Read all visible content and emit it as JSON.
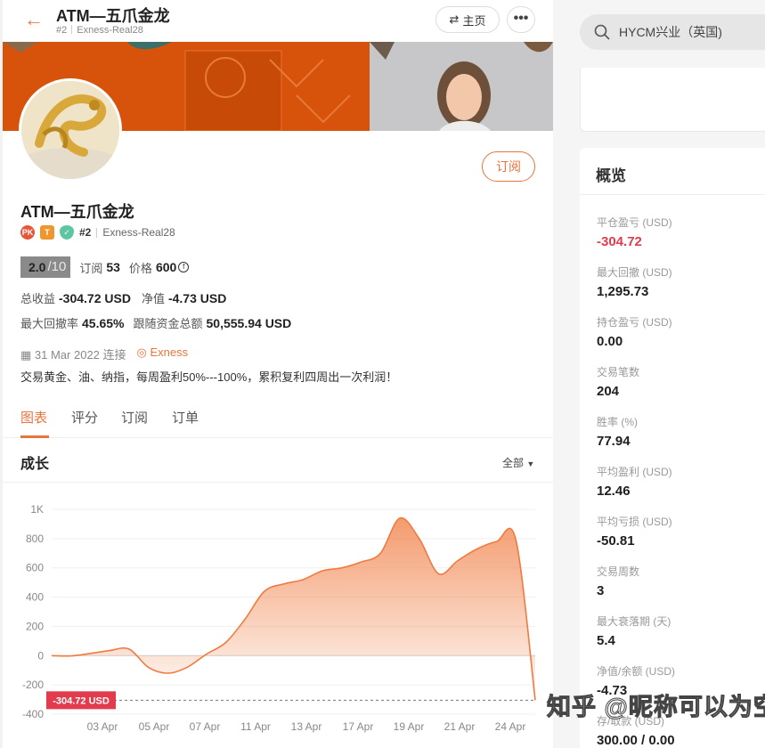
{
  "header": {
    "title": "ATM—五爪金龙",
    "rank": "#2",
    "server": "Exness-Real28",
    "home_label": "主页",
    "more_label": "•••",
    "back_label": "←"
  },
  "profile": {
    "name": "ATM—五爪金龙",
    "rank": "#2",
    "server": "Exness-Real28",
    "badges": [
      "PK",
      "T",
      "✓"
    ],
    "subscribe_label": "订阅",
    "score": "2.0",
    "score_max": "/10",
    "subs_label": "订阅",
    "subs": "53",
    "price_label": "价格",
    "price": "600",
    "total_pnl_label": "总收益",
    "total_pnl": "-304.72 USD",
    "equity_label": "净值",
    "equity": "-4.73 USD",
    "max_dd_label": "最大回撤率",
    "max_dd": "45.65%",
    "follow_label": "跟随资金总额",
    "follow": "50,555.94 USD",
    "date": "31 Mar 2022 连接",
    "broker": "Exness",
    "description": "交易黄金、油、纳指，每周盈利50%---100%，累积复利四周出一次利润！"
  },
  "tabs": [
    "图表",
    "评分",
    "订阅",
    "订单"
  ],
  "chart_section": {
    "title": "成长",
    "range": "全部"
  },
  "chart_data": {
    "type": "area",
    "x": [
      "31 Mar",
      "01 Apr",
      "02 Apr",
      "03 Apr",
      "04 Apr",
      "05 Apr",
      "06 Apr",
      "07 Apr",
      "08 Apr",
      "09 Apr",
      "10 Apr",
      "11 Apr",
      "12 Apr",
      "13 Apr",
      "14 Apr",
      "15 Apr",
      "16 Apr",
      "17 Apr",
      "18 Apr",
      "19 Apr",
      "20 Apr",
      "21 Apr",
      "22 Apr",
      "23 Apr",
      "24 Apr",
      "25 Apr"
    ],
    "y": [
      0,
      -2,
      15,
      35,
      45,
      -80,
      -120,
      -80,
      10,
      90,
      250,
      440,
      490,
      520,
      580,
      600,
      640,
      700,
      940,
      800,
      560,
      650,
      730,
      780,
      790,
      -304.72
    ],
    "xticks": [
      "03 Apr",
      "05 Apr",
      "07 Apr",
      "11 Apr",
      "13 Apr",
      "17 Apr",
      "19 Apr",
      "21 Apr",
      "24 Apr"
    ],
    "yticks": [
      "1K",
      "800",
      "600",
      "400",
      "200",
      "0",
      "-200",
      "-400"
    ],
    "ylim": [
      -400,
      1000
    ],
    "current_label": "-304.72 USD",
    "color": "#f07a3e"
  },
  "search": {
    "text": "HYCM兴业（英国)"
  },
  "overview": {
    "title": "概览",
    "items": [
      {
        "label": "平仓盈亏 (USD)",
        "value": "-304.72",
        "negative": true
      },
      {
        "label": "最大回撤 (USD)",
        "value": "1,295.73"
      },
      {
        "label": "持仓盈亏 (USD)",
        "value": "0.00"
      },
      {
        "label": "交易笔数",
        "value": "204"
      },
      {
        "label": "胜率 (%)",
        "value": "77.94"
      },
      {
        "label": "平均盈利 (USD)",
        "value": "12.46"
      },
      {
        "label": "平均亏损 (USD)",
        "value": "-50.81"
      },
      {
        "label": "交易周数",
        "value": "3"
      },
      {
        "label": "最大衰落期 (天)",
        "value": "5.4"
      },
      {
        "label": "净值/余额 (USD)",
        "value": "-4.73"
      },
      {
        "label": "存/取款 (USD)",
        "value": "300.00 / 0.00"
      }
    ]
  },
  "watermark": "知乎 @昵称可以为空"
}
